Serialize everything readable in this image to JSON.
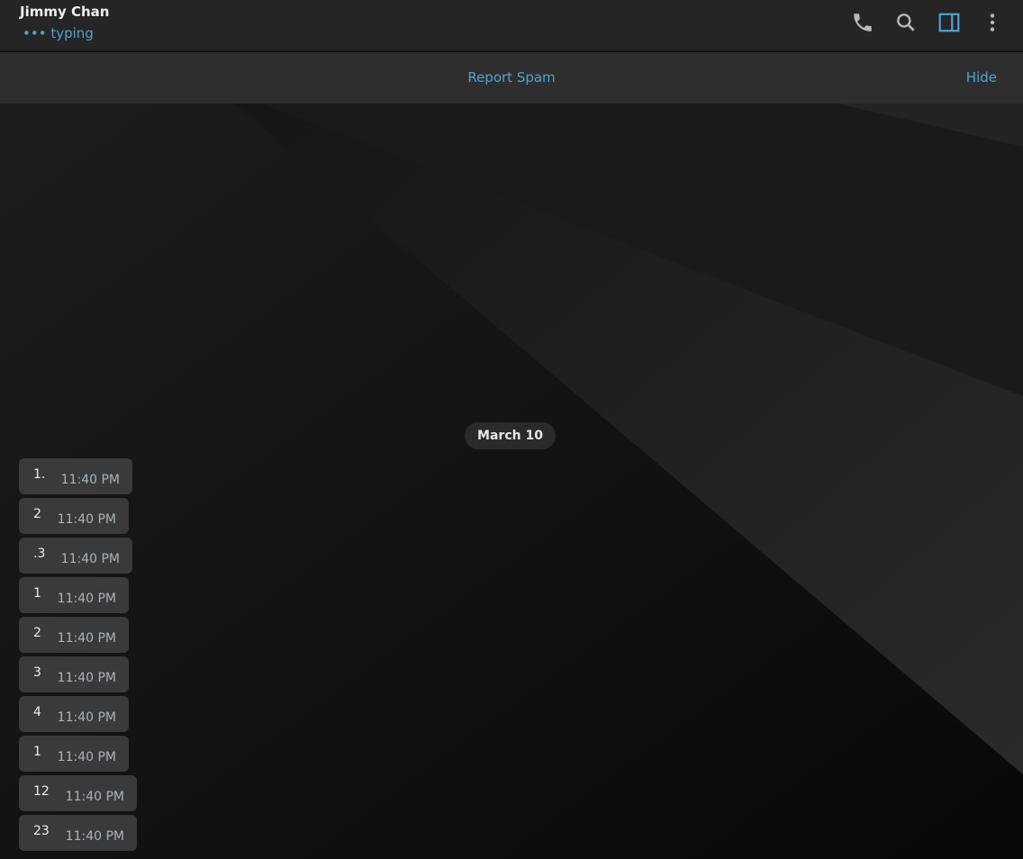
{
  "header": {
    "name": "Jimmy Chan",
    "status": "typing",
    "icons": [
      "phone-icon",
      "search-icon",
      "sidebar-toggle-icon",
      "more-vertical-icon"
    ],
    "accent": "#4ea4d0"
  },
  "spam_bar": {
    "report": "Report Spam",
    "hide": "Hide"
  },
  "date_separator": "March 10",
  "messages": [
    {
      "text": "1.",
      "time": "11:40 PM"
    },
    {
      "text": "2",
      "time": "11:40 PM"
    },
    {
      "text": ".3",
      "time": "11:40 PM"
    },
    {
      "text": "1",
      "time": "11:40 PM"
    },
    {
      "text": "2",
      "time": "11:40 PM"
    },
    {
      "text": "3",
      "time": "11:40 PM"
    },
    {
      "text": "4",
      "time": "11:40 PM"
    },
    {
      "text": "1",
      "time": "11:40 PM"
    },
    {
      "text": "12",
      "time": "11:40 PM"
    },
    {
      "text": "23",
      "time": "11:40 PM"
    }
  ]
}
